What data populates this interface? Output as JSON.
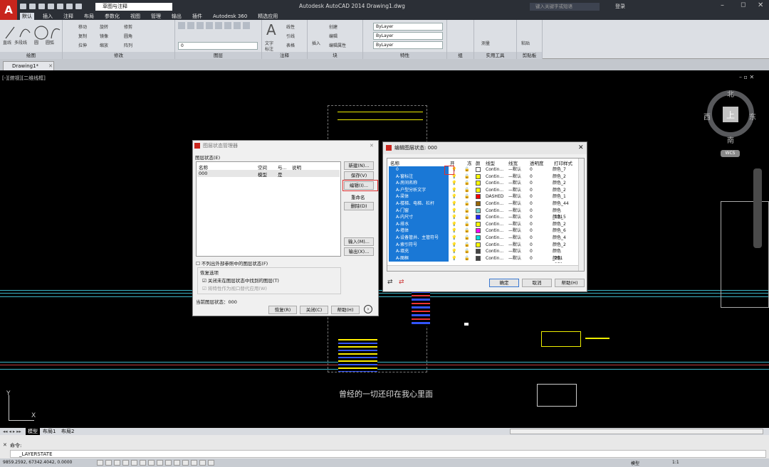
{
  "window": {
    "title": "Autodesk AutoCAD 2014   Drawing1.dwg",
    "workspace": "草图与注释",
    "search_placeholder": "键入关键字或短语",
    "login": "登录"
  },
  "ribbon_tabs": [
    "默认",
    "插入",
    "注释",
    "布局",
    "参数化",
    "视图",
    "管理",
    "输出",
    "插件",
    "Autodesk 360",
    "精选应用"
  ],
  "ribbon_panels": [
    "绘图",
    "修改",
    "图层",
    "注释",
    "块",
    "特性",
    "组",
    "实用工具",
    "剪贴板"
  ],
  "draw_tools": [
    "直线",
    "多段线",
    "圆",
    "圆弧"
  ],
  "modify_tools": [
    "移动",
    "旋转",
    "修剪",
    "复制",
    "镜像",
    "圆角",
    "拉伸",
    "缩放",
    "阵列"
  ],
  "layer_value": "0",
  "annot_tools": [
    "文字",
    "标注",
    "线性",
    "引线",
    "表格"
  ],
  "block_tools": [
    "插入",
    "创建",
    "编辑",
    "编辑属性"
  ],
  "props": [
    "ByLayer",
    "ByLayer",
    "ByLayer"
  ],
  "util_tools": [
    "测量",
    "粘贴"
  ],
  "doc_tab": "Drawing1*",
  "view_label": "[-][俯视][二维线框]",
  "compass": {
    "n": "北",
    "s": "南",
    "e": "东",
    "w": "西",
    "top": "上",
    "ucs": "WCS"
  },
  "canvas_text": "曾经的一切还印在我心里面",
  "layer_state_manager": {
    "title": "图层状态管理器",
    "list_label": "图层状态(E)",
    "headers": [
      "名称",
      "空间",
      "与...",
      "说明"
    ],
    "row": [
      "000",
      "模型",
      "是",
      ""
    ],
    "buttons": [
      "新建(N)...",
      "保存(V)",
      "编辑(I)...",
      "重命名",
      "删除(D)",
      "输入(M)...",
      "输出(X)..."
    ],
    "check_external": "不列出外部参照中的图层状态(F)",
    "restore_label": "恢复选项",
    "check_close": "关闭未在图层状态中找到的图层(T)",
    "check_viewport": "将特性作为视口替代应用(W)",
    "current_label": "当前图层状态：000",
    "bottom_buttons": [
      "恢复(R)",
      "关闭(C)",
      "帮助(H)"
    ]
  },
  "edit_layer_state": {
    "title": "编辑图层状态: 000",
    "headers": [
      "名称",
      "开",
      "冻",
      "颜",
      "线型",
      "线宽",
      "透明度",
      "打印样式"
    ],
    "rows": [
      {
        "name": "0",
        "color": "#ffffff",
        "lt": "Contin...",
        "lw": "—默认",
        "tr": "0",
        "ps": "颜色_7"
      },
      {
        "name": "A-窗标注",
        "color": "#ffff00",
        "lt": "Contin...",
        "lw": "—默认",
        "tr": "0",
        "ps": "颜色_2"
      },
      {
        "name": "A-房间名称",
        "color": "#ffff00",
        "lt": "Contin...",
        "lw": "—默认",
        "tr": "0",
        "ps": "颜色_2"
      },
      {
        "name": "A-户型分析文字",
        "color": "#ffff00",
        "lt": "Contin...",
        "lw": "—默认",
        "tr": "0",
        "ps": "颜色_2"
      },
      {
        "name": "A-梁体",
        "color": "#ff0000",
        "lt": "DASHED",
        "lw": "—默认",
        "tr": "0",
        "ps": "颜色_1"
      },
      {
        "name": "A-楼梯、电梯、栏杆",
        "color": "#996600",
        "lt": "Contin...",
        "lw": "—默认",
        "tr": "0",
        "ps": "颜色_44"
      },
      {
        "name": "A-门窗",
        "color": "#66cccc",
        "lt": "Contin...",
        "lw": "—默认",
        "tr": "0",
        "ps": "颜色_131"
      },
      {
        "name": "A-内尺寸",
        "color": "#2222ff",
        "lt": "Contin...",
        "lw": "—默认",
        "tr": "0",
        "ps": "颜色_5"
      },
      {
        "name": "A-排水",
        "color": "#ffff00",
        "lt": "Contin...",
        "lw": "—默认",
        "tr": "0",
        "ps": "颜色_2"
      },
      {
        "name": "A-墙体",
        "color": "#ff00ff",
        "lt": "Contin...",
        "lw": "—默认",
        "tr": "0",
        "ps": "颜色_6"
      },
      {
        "name": "A-设备管井、主管符号",
        "color": "#00dddd",
        "lt": "Contin...",
        "lw": "—默认",
        "tr": "0",
        "ps": "颜色_4"
      },
      {
        "name": "A-索引符号",
        "color": "#ffff00",
        "lt": "Contin...",
        "lw": "—默认",
        "tr": "0",
        "ps": "颜色_2"
      },
      {
        "name": "A-填充",
        "color": "#444444",
        "lt": "Contin...",
        "lw": "—默认",
        "tr": "0",
        "ps": "颜色_251"
      },
      {
        "name": "A-图框",
        "color": "#444444",
        "lt": "Contin...",
        "lw": "—默认",
        "tr": "0",
        "ps": "颜色_251"
      }
    ],
    "buttons": [
      "确定",
      "取消",
      "帮助(H)"
    ]
  },
  "layout_tabs": [
    "模型",
    "布局1",
    "布局2"
  ],
  "command": {
    "label": "命令:",
    "input": "_LAYERSTATE"
  },
  "coords": "9859.2592,  67342.4042, 0.0000",
  "status_right": [
    "模型",
    "1:1"
  ]
}
